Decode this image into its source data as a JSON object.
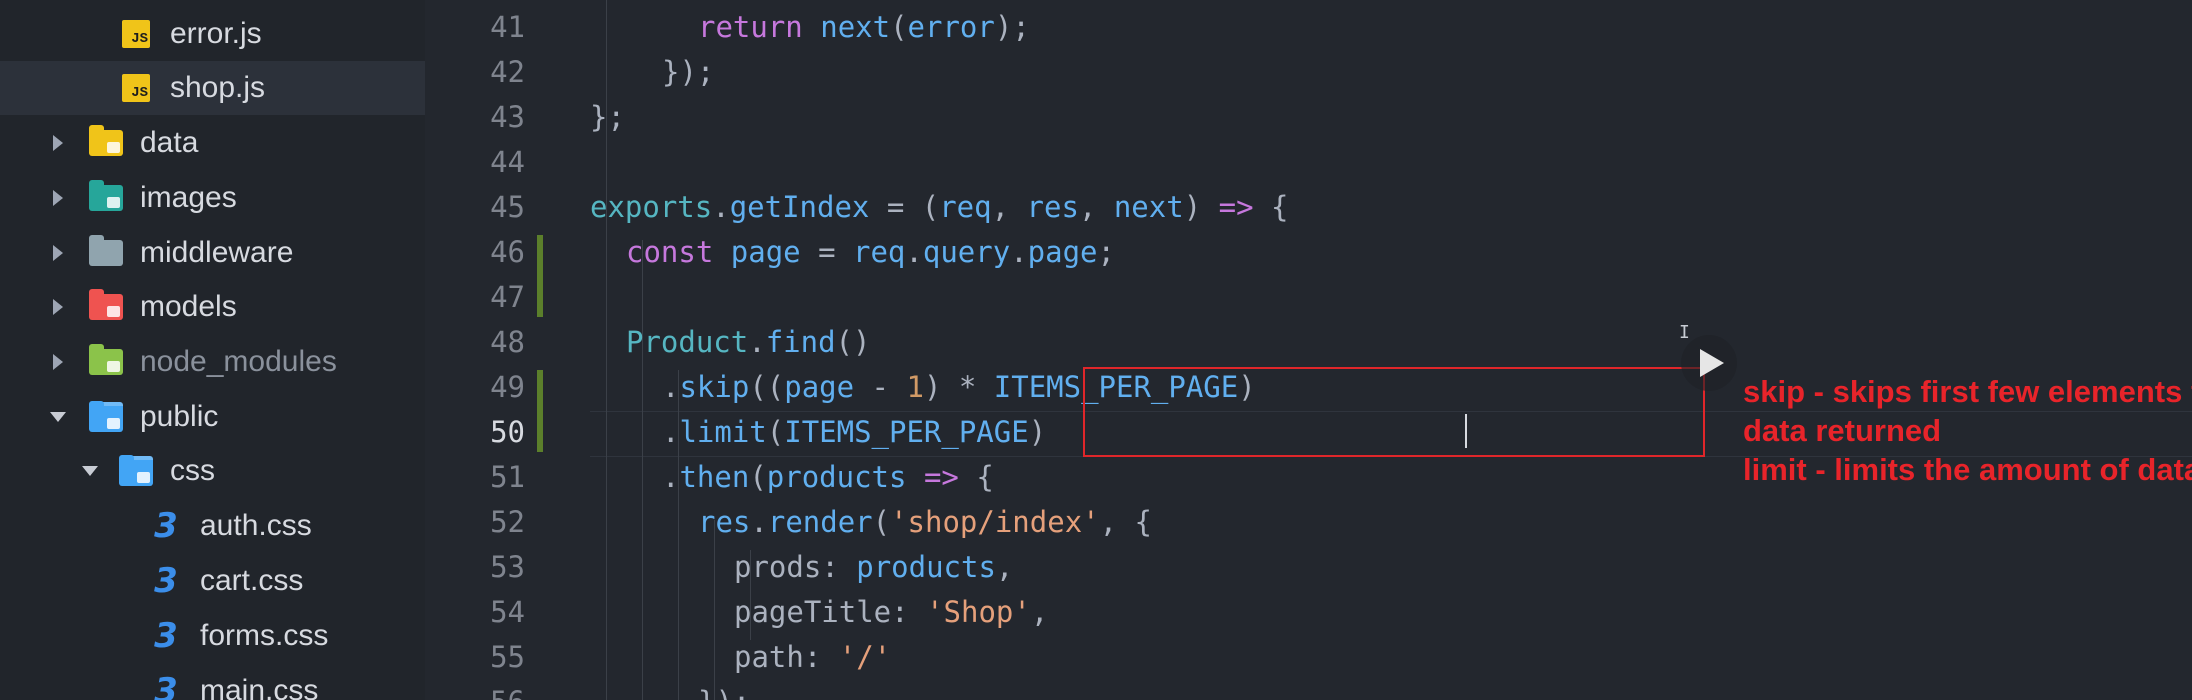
{
  "sidebar": {
    "items": [
      {
        "label": "error.js",
        "type": "file",
        "icon": "js-file-icon"
      },
      {
        "label": "shop.js",
        "type": "file",
        "icon": "js-file-icon",
        "selected": true
      },
      {
        "label": "data",
        "type": "folder",
        "icon": "database-folder-icon",
        "color": "#f0c419"
      },
      {
        "label": "images",
        "type": "folder",
        "icon": "images-folder-icon",
        "color": "#26a69a"
      },
      {
        "label": "middleware",
        "type": "folder",
        "icon": "folder-icon",
        "color": "#90a4ae"
      },
      {
        "label": "models",
        "type": "folder",
        "icon": "models-folder-icon",
        "color": "#ef5350"
      },
      {
        "label": "node_modules",
        "type": "folder",
        "icon": "node-folder-icon",
        "color": "#8bc34a"
      },
      {
        "label": "public",
        "type": "folder",
        "icon": "public-folder-icon",
        "color": "#42a5f5",
        "expanded": true
      },
      {
        "label": "css",
        "type": "folder",
        "icon": "css-folder-icon",
        "color": "#42a5f5",
        "expanded": true
      },
      {
        "label": "auth.css",
        "type": "file",
        "icon": "css-file-icon"
      },
      {
        "label": "cart.css",
        "type": "file",
        "icon": "css-file-icon"
      },
      {
        "label": "forms.css",
        "type": "file",
        "icon": "css-file-icon"
      },
      {
        "label": "main.css",
        "type": "file",
        "icon": "css-file-icon"
      }
    ]
  },
  "editor": {
    "current_line": "50",
    "lines": [
      {
        "no": "41",
        "tokens": [
          [
            "kw",
            "return"
          ],
          [
            "pl",
            " "
          ],
          [
            "fn",
            "next"
          ],
          [
            "pl",
            "("
          ],
          [
            "vr",
            "error"
          ],
          [
            "pl",
            ");"
          ]
        ]
      },
      {
        "no": "42",
        "tokens": [
          [
            "pl",
            "});"
          ]
        ]
      },
      {
        "no": "43",
        "tokens": [
          [
            "pl",
            "};"
          ]
        ]
      },
      {
        "no": "44",
        "tokens": []
      },
      {
        "no": "45",
        "tokens": [
          [
            "exp",
            "exports"
          ],
          [
            "pl",
            "."
          ],
          [
            "fn",
            "getIndex"
          ],
          [
            "pl",
            " = ("
          ],
          [
            "vr",
            "req"
          ],
          [
            "pl",
            ", "
          ],
          [
            "vr",
            "res"
          ],
          [
            "pl",
            ", "
          ],
          [
            "vr",
            "next"
          ],
          [
            "pl",
            ") "
          ],
          [
            "kw",
            "=>"
          ],
          [
            "pl",
            " {"
          ]
        ]
      },
      {
        "no": "46",
        "tokens": [
          [
            "kw",
            "const"
          ],
          [
            "pl",
            " "
          ],
          [
            "vr",
            "page"
          ],
          [
            "pl",
            " = "
          ],
          [
            "vr",
            "req"
          ],
          [
            "pl",
            "."
          ],
          [
            "prop",
            "query"
          ],
          [
            "pl",
            "."
          ],
          [
            "prop",
            "page"
          ],
          [
            "pl",
            ";"
          ]
        ]
      },
      {
        "no": "47",
        "tokens": []
      },
      {
        "no": "48",
        "tokens": [
          [
            "cls",
            "Product"
          ],
          [
            "pl",
            "."
          ],
          [
            "fn",
            "find"
          ],
          [
            "pl",
            "()"
          ]
        ]
      },
      {
        "no": "49",
        "tokens": [
          [
            "pl",
            "."
          ],
          [
            "fn",
            "skip"
          ],
          [
            "pl",
            "(("
          ],
          [
            "vr",
            "page"
          ],
          [
            "pl",
            " - "
          ],
          [
            "or",
            "1"
          ],
          [
            "pl",
            ") * "
          ],
          [
            "vr",
            "ITEMS_PER_PAGE"
          ],
          [
            "pl",
            ")"
          ]
        ]
      },
      {
        "no": "50",
        "tokens": [
          [
            "pl",
            "."
          ],
          [
            "fn",
            "limit"
          ],
          [
            "pl",
            "("
          ],
          [
            "vr",
            "ITEMS_PER_PAGE"
          ],
          [
            "pl",
            ")"
          ]
        ]
      },
      {
        "no": "51",
        "tokens": [
          [
            "pl",
            "."
          ],
          [
            "fn",
            "then"
          ],
          [
            "pl",
            "("
          ],
          [
            "vr",
            "products"
          ],
          [
            "pl",
            " "
          ],
          [
            "kw",
            "=>"
          ],
          [
            "pl",
            " {"
          ]
        ]
      },
      {
        "no": "52",
        "tokens": [
          [
            "vr",
            "res"
          ],
          [
            "pl",
            "."
          ],
          [
            "fn",
            "render"
          ],
          [
            "pl",
            "("
          ],
          [
            "str",
            "'shop/index'"
          ],
          [
            "pl",
            ", {"
          ]
        ]
      },
      {
        "no": "53",
        "tokens": [
          [
            "keyp",
            "prods"
          ],
          [
            "pl",
            ": "
          ],
          [
            "vr",
            "products"
          ],
          [
            "pl",
            ","
          ]
        ]
      },
      {
        "no": "54",
        "tokens": [
          [
            "keyp",
            "pageTitle"
          ],
          [
            "pl",
            ": "
          ],
          [
            "str",
            "'Shop'"
          ],
          [
            "pl",
            ","
          ]
        ]
      },
      {
        "no": "55",
        "tokens": [
          [
            "keyp",
            "path"
          ],
          [
            "pl",
            ": "
          ],
          [
            "str",
            "'/'"
          ]
        ]
      },
      {
        "no": "56",
        "tokens": [
          [
            "pl",
            "});"
          ]
        ]
      }
    ]
  },
  "annotation": {
    "lines": [
      "skip - skips first few elements from the",
      "data returned",
      "limit - limits the amount of data returned"
    ],
    "color": "#e8242a"
  }
}
